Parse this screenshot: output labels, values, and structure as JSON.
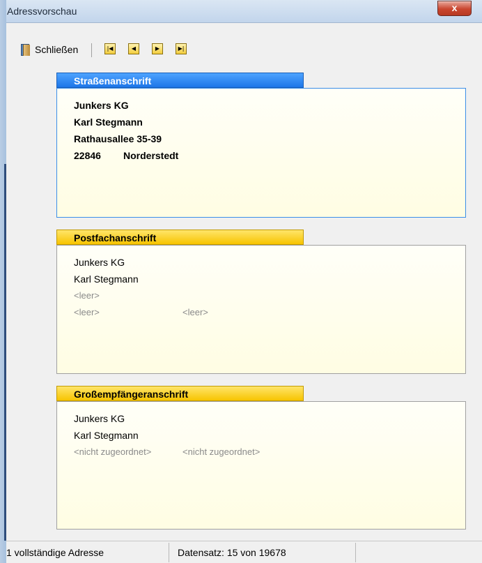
{
  "window": {
    "title": "Adressvorschau",
    "close_label": "x"
  },
  "toolbar": {
    "close_label": "Schließen",
    "nav": [
      {
        "name": "first-record",
        "glyph": "|◀"
      },
      {
        "name": "previous-record",
        "glyph": "◀"
      },
      {
        "name": "next-record",
        "glyph": "▶"
      },
      {
        "name": "last-record",
        "glyph": "▶|"
      }
    ]
  },
  "panels": {
    "street": {
      "title": "Straßenanschrift",
      "company": "Junkers KG",
      "person": "Karl Stegmann",
      "street": "Rathausallee 35-39",
      "zip": "22846",
      "city": "Norderstedt"
    },
    "pobox": {
      "title": "Postfachanschrift",
      "company": "Junkers KG",
      "person": "Karl Stegmann",
      "pobox": "<leer>",
      "zip": "<leer>",
      "city": "<leer>"
    },
    "bulk": {
      "title": "Großempfängeranschrift",
      "company": "Junkers KG",
      "person": "Karl Stegmann",
      "zip": "<nicht zugeordnet>",
      "city": "<nicht zugeordnet>"
    }
  },
  "status": {
    "complete": "1 vollständige Adresse",
    "record": "Datensatz: 15 von 19678"
  },
  "colors": {
    "accent_blue": "#1d76e8",
    "accent_yellow": "#f7c400",
    "box_bg": "#fffde3"
  }
}
